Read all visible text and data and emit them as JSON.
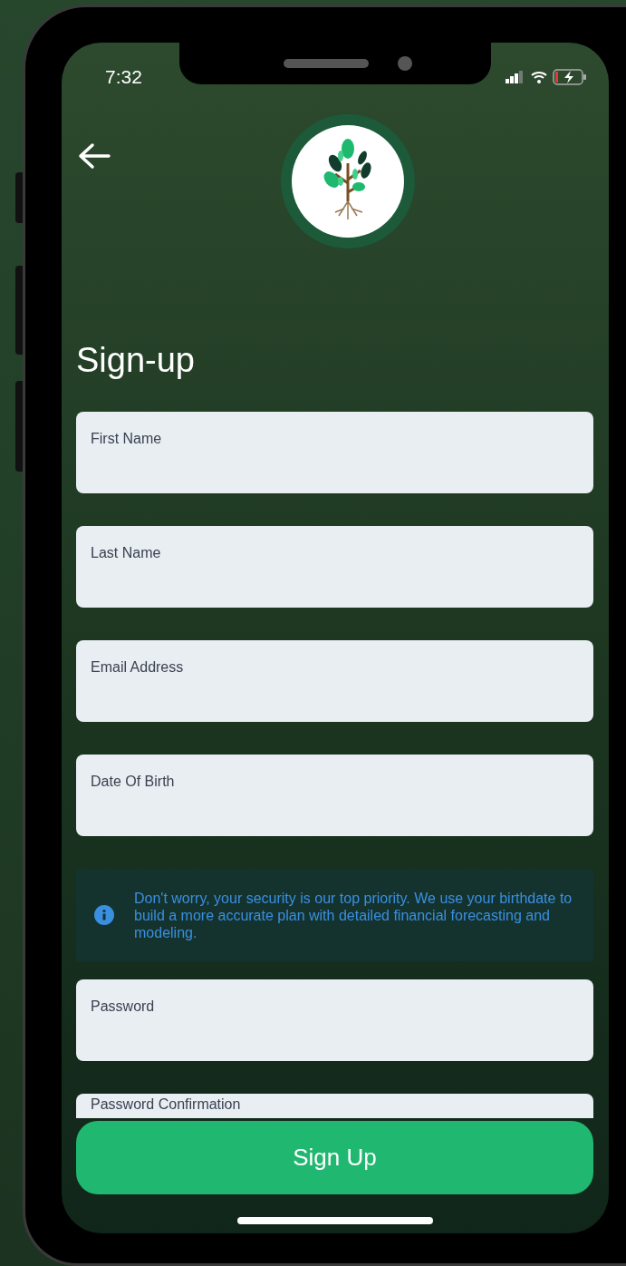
{
  "status_bar": {
    "time": "7:32"
  },
  "title": "Sign-up",
  "fields": [
    {
      "kind": "input",
      "label": "First Name"
    },
    {
      "kind": "input",
      "label": "Last Name"
    },
    {
      "kind": "input",
      "label": "Email Address"
    },
    {
      "kind": "input",
      "label": "Date Of Birth"
    },
    {
      "kind": "notice",
      "text": "Don't worry, your security is our top priority. We use your birthdate to build a more accurate plan with detailed financial forecasting and modeling."
    },
    {
      "kind": "input",
      "label": "Password"
    },
    {
      "kind": "input",
      "label": "Password Confirmation"
    }
  ],
  "submit_button": "Sign Up"
}
